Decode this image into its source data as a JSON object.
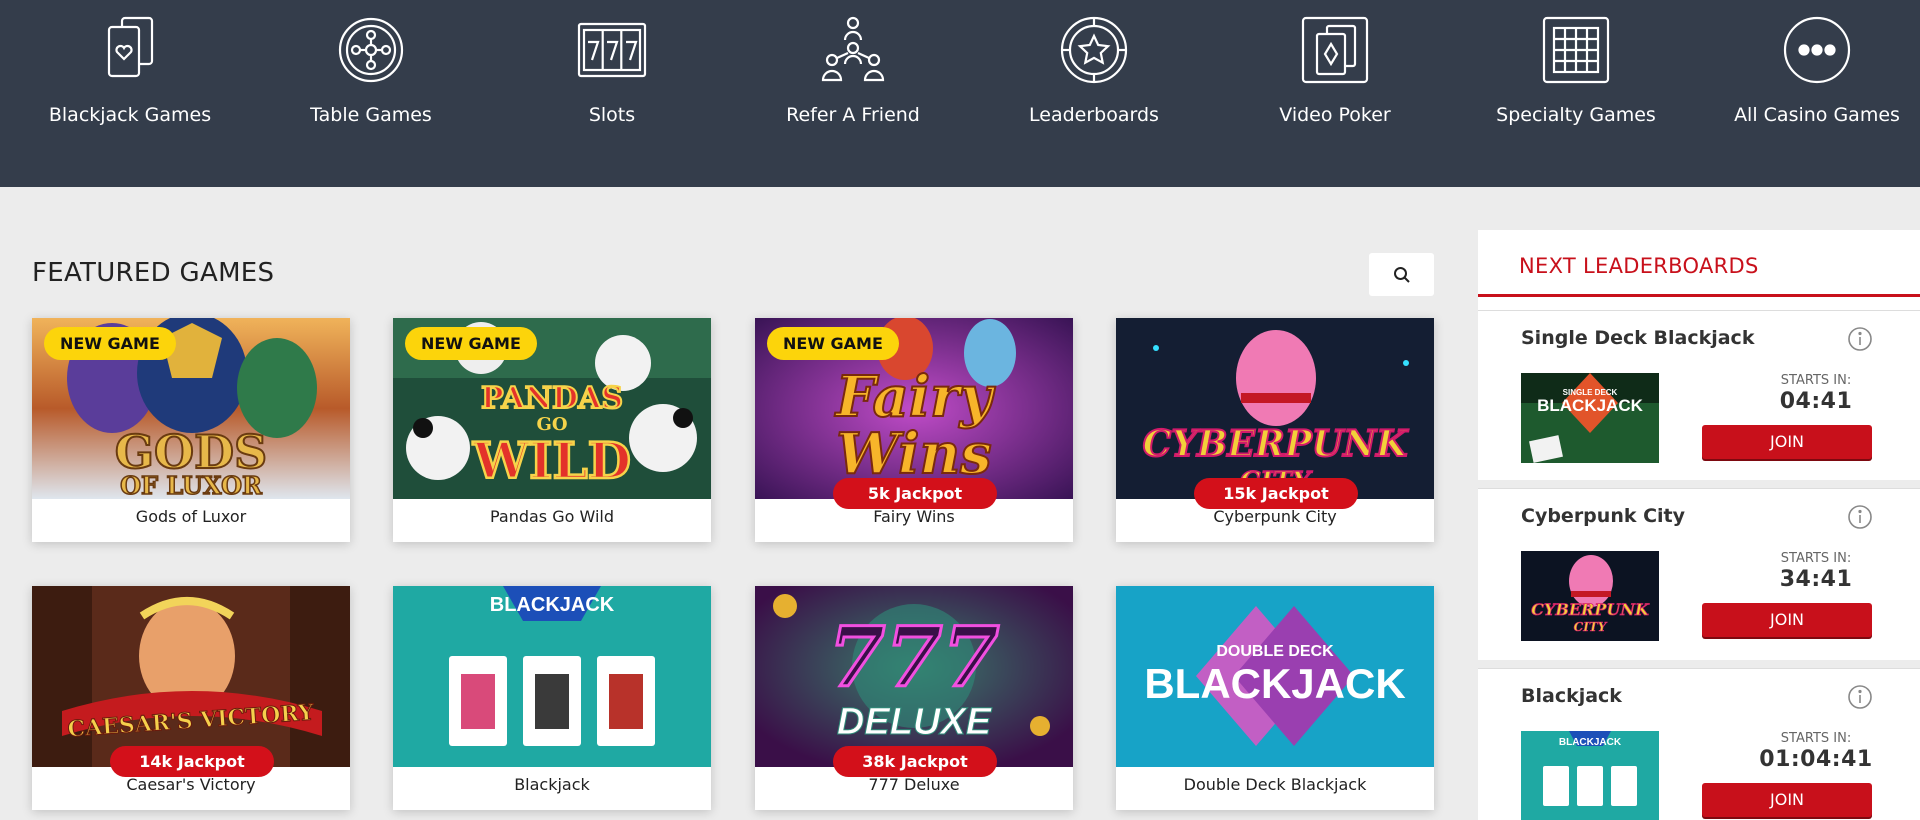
{
  "nav": {
    "items": [
      {
        "label": "Blackjack Games",
        "icon": "cards-heart-icon"
      },
      {
        "label": "Table Games",
        "icon": "roulette-icon"
      },
      {
        "label": "Slots",
        "icon": "slots-777-icon"
      },
      {
        "label": "Refer A Friend",
        "icon": "people-network-icon"
      },
      {
        "label": "Leaderboards",
        "icon": "star-chip-icon"
      },
      {
        "label": "Video Poker",
        "icon": "cards-diamond-icon"
      },
      {
        "label": "Specialty Games",
        "icon": "grid-ticket-icon"
      },
      {
        "label": "All Casino Games",
        "icon": "more-dots-icon"
      }
    ]
  },
  "featured": {
    "title": "FEATURED GAMES",
    "search_icon": "search-icon",
    "games": [
      {
        "name": "Gods of Luxor",
        "badge_new": "NEW GAME",
        "jackpot": "",
        "art": [
          "GODS",
          "OF LUXOR"
        ]
      },
      {
        "name": "Pandas Go Wild",
        "badge_new": "NEW GAME",
        "jackpot": "",
        "art": [
          "PANDAS",
          "GO",
          "WILD"
        ]
      },
      {
        "name": "Fairy Wins",
        "badge_new": "NEW GAME",
        "jackpot": "5k Jackpot",
        "art": [
          "Fairy",
          "Wins"
        ]
      },
      {
        "name": "Cyberpunk City",
        "badge_new": "",
        "jackpot": "15k Jackpot",
        "art": [
          "CYBERPUNK",
          "CITY"
        ]
      },
      {
        "name": "Caesar's Victory",
        "badge_new": "",
        "jackpot": "14k Jackpot",
        "art": [
          "CAESAR'S VICTORY"
        ]
      },
      {
        "name": "Blackjack",
        "badge_new": "",
        "jackpot": "",
        "art": [
          "BLACKJACK"
        ]
      },
      {
        "name": "777 Deluxe",
        "badge_new": "",
        "jackpot": "38k Jackpot",
        "art": [
          "777",
          "DELUXE"
        ]
      },
      {
        "name": "Double Deck Blackjack",
        "badge_new": "",
        "jackpot": "",
        "art": [
          "DOUBLE DECK",
          "BLACKJACK"
        ]
      }
    ]
  },
  "leaderboards": {
    "title": "NEXT LEADERBOARDS",
    "items": [
      {
        "name": "Single Deck Blackjack",
        "starts_label": "STARTS IN:",
        "timer": "04:41",
        "join": "JOIN",
        "art": [
          "SINGLE DECK",
          "BLACKJACK"
        ]
      },
      {
        "name": "Cyberpunk City",
        "starts_label": "STARTS IN:",
        "timer": "34:41",
        "join": "JOIN",
        "art": [
          "CYBERPUNK",
          "CITY"
        ]
      },
      {
        "name": "Blackjack",
        "starts_label": "STARTS IN:",
        "timer": "01:04:41",
        "join": "JOIN",
        "art": [
          "BLACKJACK"
        ]
      }
    ]
  },
  "colors": {
    "nav_bg": "#343d4b",
    "accent_red": "#c8101b",
    "badge_yellow": "#fcd40b",
    "page_bg": "#ececec"
  }
}
